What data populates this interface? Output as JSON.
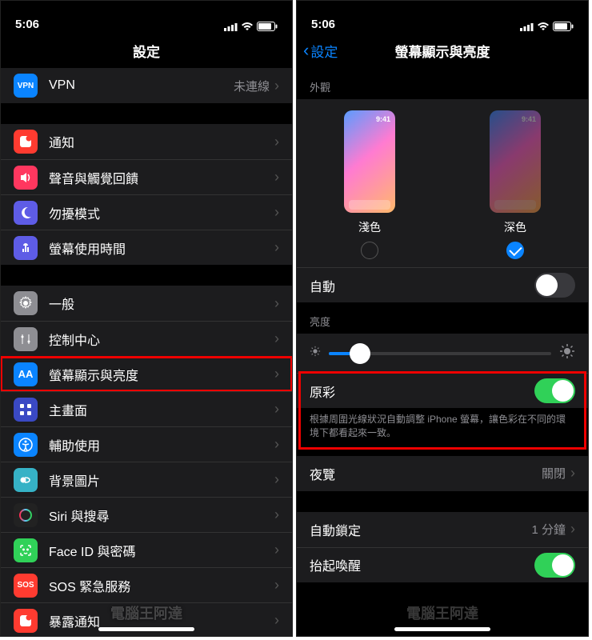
{
  "left": {
    "time": "5:06",
    "title": "設定",
    "groups": [
      [
        {
          "icon": "vpn",
          "bg": "#0a84ff",
          "label": "VPN",
          "detail": "未連線"
        }
      ],
      [
        {
          "icon": "notify",
          "bg": "#ff3b30",
          "label": "通知"
        },
        {
          "icon": "sound",
          "bg": "#ff375f",
          "label": "聲音與觸覺回饋"
        },
        {
          "icon": "dnd",
          "bg": "#5e5ce6",
          "label": "勿擾模式"
        },
        {
          "icon": "screentime",
          "bg": "#5e5ce6",
          "label": "螢幕使用時間"
        }
      ],
      [
        {
          "icon": "general",
          "bg": "#8e8e93",
          "label": "一般"
        },
        {
          "icon": "control",
          "bg": "#8e8e93",
          "label": "控制中心"
        },
        {
          "icon": "display",
          "bg": "#0a84ff",
          "label": "螢幕顯示與亮度",
          "hl": true
        },
        {
          "icon": "home",
          "bg": "#3a49c4",
          "label": "主畫面"
        },
        {
          "icon": "access",
          "bg": "#0a84ff",
          "label": "輔助使用"
        },
        {
          "icon": "wallpaper",
          "bg": "#36b2c6",
          "label": "背景圖片"
        },
        {
          "icon": "siri",
          "bg": "#222",
          "label": "Siri 與搜尋"
        },
        {
          "icon": "faceid",
          "bg": "#30d158",
          "label": "Face ID 與密碼"
        },
        {
          "icon": "sos",
          "bg": "#ff3b30",
          "label": "SOS 緊急服務"
        },
        {
          "icon": "notify",
          "bg": "#ff3b30",
          "label": "暴露通知"
        }
      ]
    ]
  },
  "right": {
    "time": "5:06",
    "back": "設定",
    "title": "螢幕顯示與亮度",
    "appearance_header": "外觀",
    "light_label": "淺色",
    "dark_label": "深色",
    "thumb_time": "9:41",
    "auto_label": "自動",
    "brightness_header": "亮度",
    "brightness_pct": 14,
    "truetone_label": "原彩",
    "truetone_footer": "根據周圍光線狀況自動調整 iPhone 螢幕，讓色彩在不同的環境下都看起來一致。",
    "nightshift_label": "夜覽",
    "nightshift_detail": "關閉",
    "autolock_label": "自動鎖定",
    "autolock_detail": "1 分鐘",
    "raise_label": "抬起喚醒"
  },
  "watermark": "電腦王阿達"
}
